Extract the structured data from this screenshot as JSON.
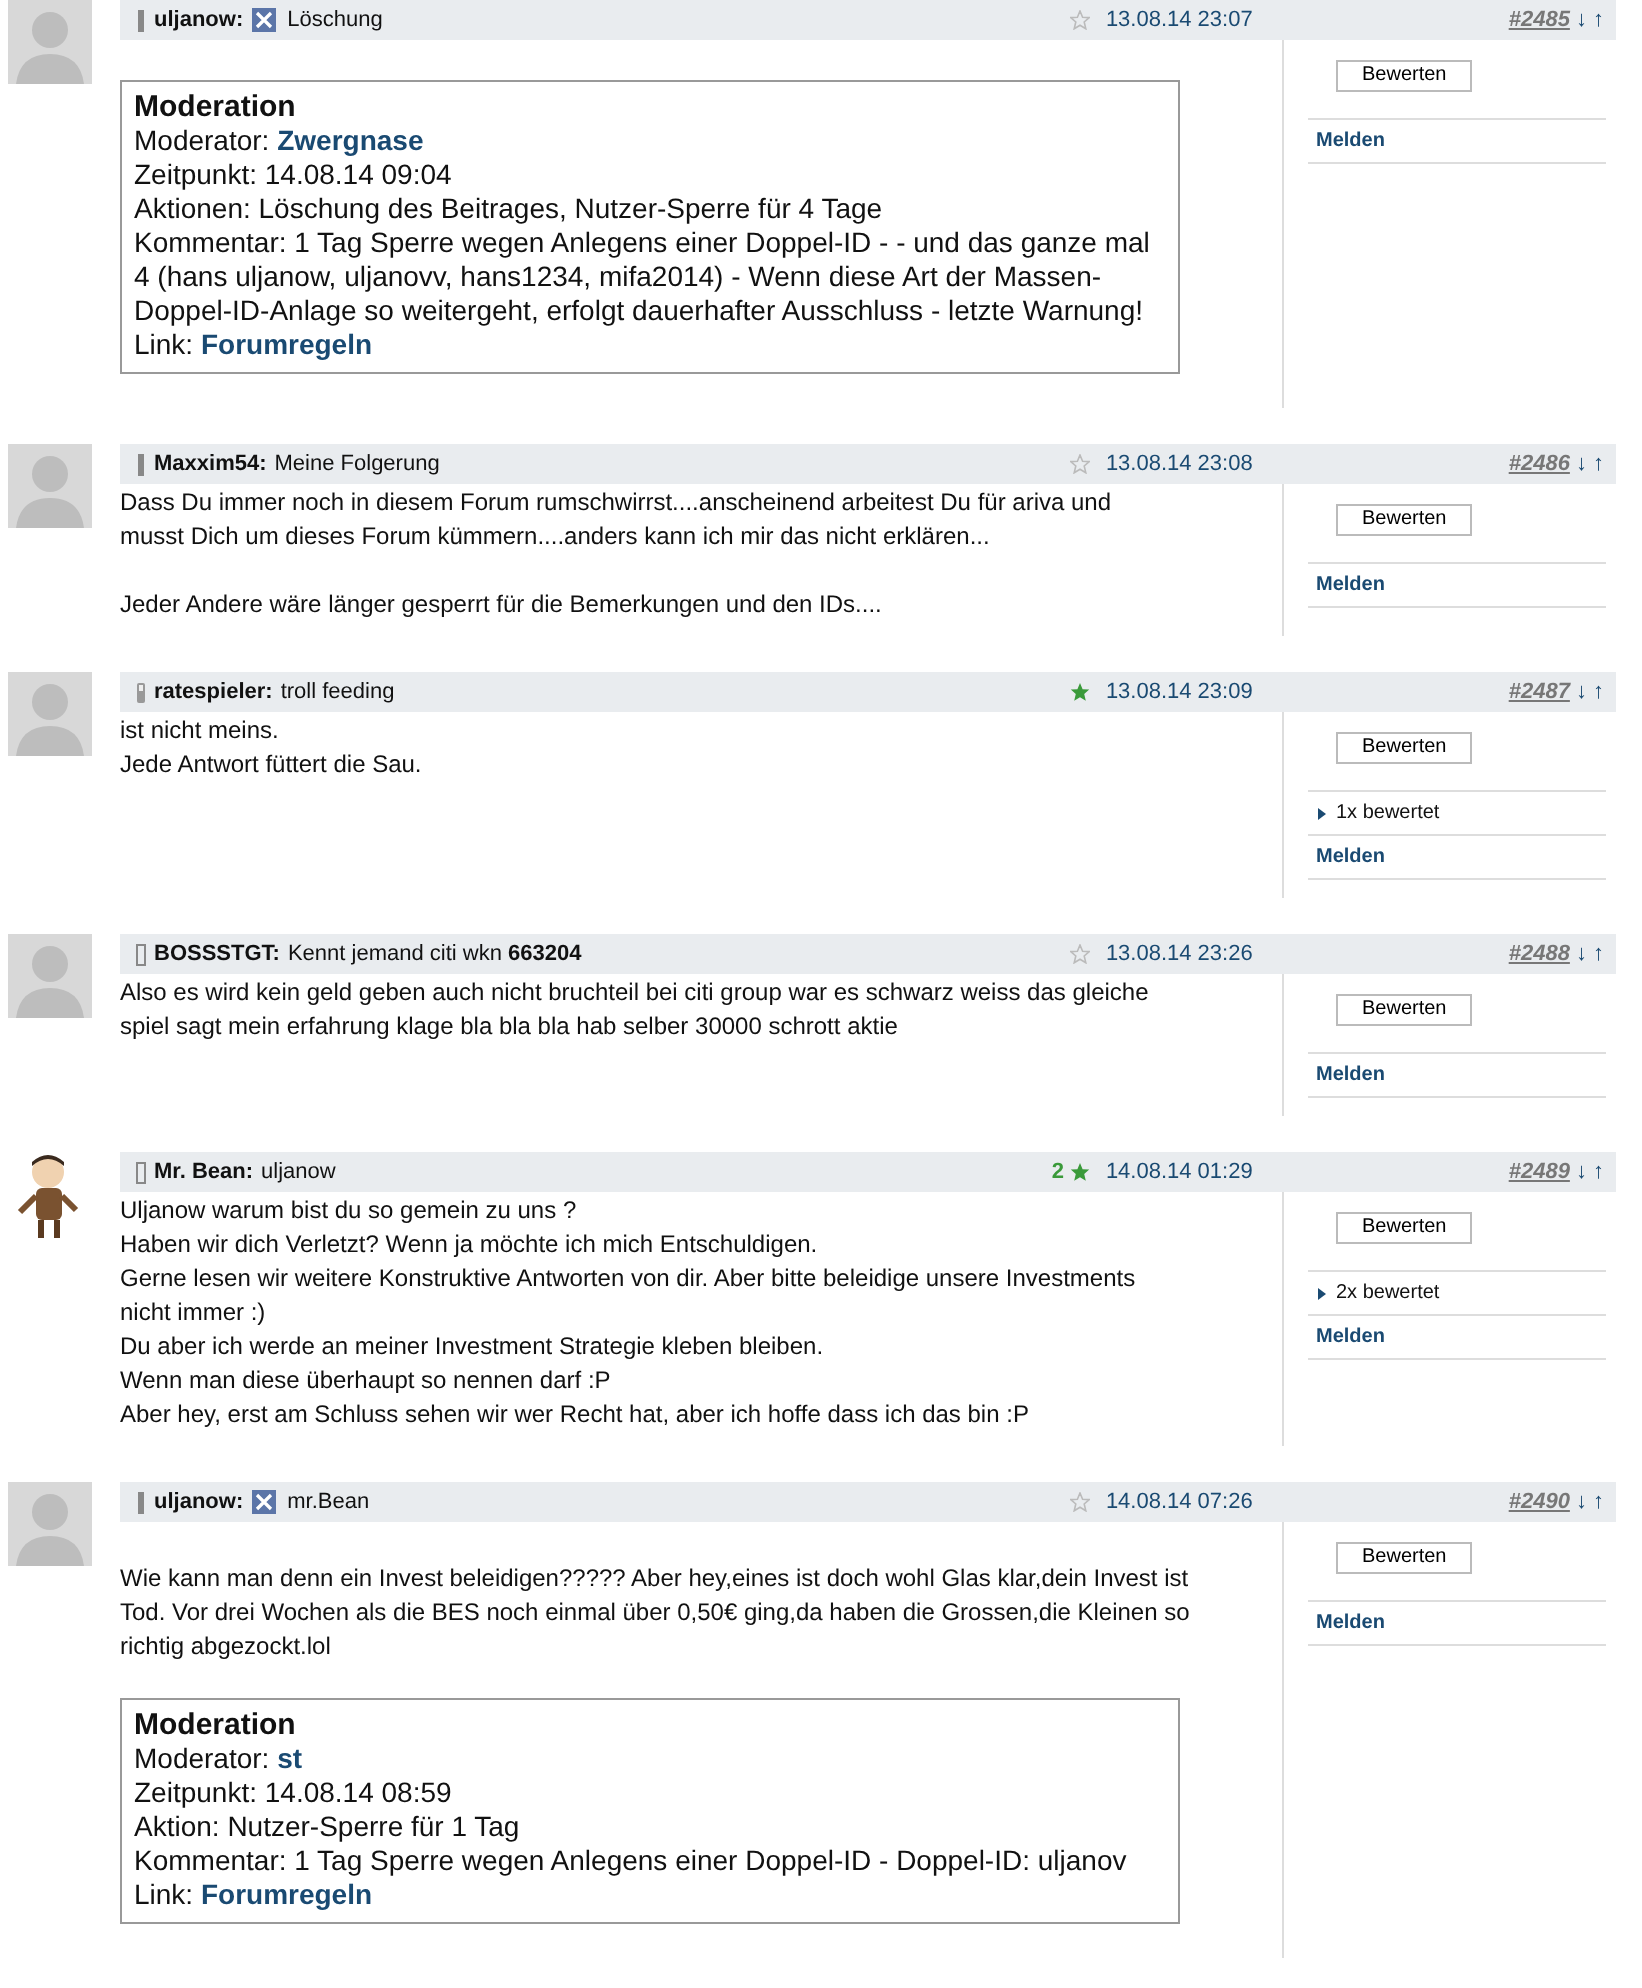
{
  "posts": [
    {
      "avatar": {
        "kind": "silhouette"
      },
      "status_icon": {
        "kind": "bar"
      },
      "author": "uljanow:",
      "x_mark": true,
      "title": "Löschung",
      "starred": false,
      "date": "13.08.14 23:07",
      "number": "#2485",
      "arrows": "↓ ↑",
      "gap_before": true,
      "moderation": {
        "title": "Moderation",
        "lines": [
          {
            "kind": "link",
            "label": "Moderator:",
            "link": "Zwergnase"
          },
          {
            "kind": "text",
            "text": "Zeitpunkt: 14.08.14 09:04"
          },
          {
            "kind": "text",
            "text": "Aktionen: Löschung des Beitrages, Nutzer-Sperre für 4 Tage"
          },
          {
            "kind": "text",
            "text": "Kommentar: 1 Tag Sperre wegen Anlegens einer Doppel-ID -  - und das ganze mal 4 (hans uljanow, uljanovv, hans1234, mifa2014) - Wenn diese Art der Massen-Doppel-ID-Anlage so weitergeht, erfolgt dauerhafter Ausschluss - letzte Warnung!"
          },
          {
            "kind": "link",
            "label": "Link:",
            "link": "Forumregeln"
          }
        ]
      },
      "sidebar": {
        "rate_button": "Bewerten",
        "report_link": "Melden"
      }
    },
    {
      "avatar": {
        "kind": "silhouette"
      },
      "status_icon": {
        "kind": "bar"
      },
      "author": "Maxxim54:",
      "x_mark": false,
      "title": "Meine Folgerung",
      "starred": false,
      "date": "13.08.14 23:08",
      "number": "#2486",
      "arrows": "↓ ↑",
      "gap_before": false,
      "paragraphs": [
        "Dass Du immer noch in diesem Forum rumschwirrst....anscheinend arbeitest Du für ariva und\nmusst Dich um dieses Forum kümmern....anders kann ich mir das nicht erklären...",
        "Jeder Andere wäre länger gesperrt für die Bemerkungen und den IDs...."
      ],
      "sidebar": {
        "rate_button": "Bewerten",
        "report_link": "Melden"
      }
    },
    {
      "avatar": {
        "kind": "silhouette"
      },
      "status_icon": {
        "kind": "phone"
      },
      "author": "ratespieler:",
      "x_mark": false,
      "title": "troll feeding",
      "starred": true,
      "date": "13.08.14 23:09",
      "number": "#2487",
      "arrows": "↓ ↑",
      "gap_before": false,
      "paragraphs": [
        "ist nicht meins.\nJede Antwort füttert die Sau."
      ],
      "sidebar": {
        "rate_button": "Bewerten",
        "ratings": {
          "label": "1x bewertet",
          "expanded": false
        },
        "report_link": "Melden"
      }
    },
    {
      "avatar": {
        "kind": "silhouette"
      },
      "status_icon": {
        "kind": "outline"
      },
      "author": "BOSSSTGT:",
      "x_mark": false,
      "title": "Kennt jemand citi wkn **663204**",
      "starred": false,
      "date": "13.08.14 23:26",
      "number": "#2488",
      "arrows": "↓ ↑",
      "gap_before": false,
      "paragraphs": [
        "Also es wird kein geld geben auch nicht bruchteil bei citi group war es schwarz weiss das gleiche\nspiel sagt mein erfahrung klage bla bla bla hab selber 30000 schrott aktie"
      ],
      "sidebar": {
        "rate_button": "Bewerten",
        "report_link": "Melden"
      }
    },
    {
      "avatar": {
        "kind": "figure"
      },
      "status_icon": {
        "kind": "outline"
      },
      "author": "Mr. Bean:",
      "x_mark": false,
      "title": "uljanow",
      "rating_count": "2",
      "starred": true,
      "date": "14.08.14 01:29",
      "number": "#2489",
      "arrows": "↓ ↑",
      "gap_before": false,
      "paragraphs": [
        "Uljanow warum bist du so gemein zu uns ?\nHaben wir dich Verletzt? Wenn ja möchte ich mich Entschuldigen.\nGerne lesen wir weitere Konstruktive Antworten von dir. Aber bitte beleidige unsere Investments\nnicht immer :)\nDu aber ich werde an meiner Investment Strategie kleben bleiben.\nWenn man diese überhaupt so nennen darf :P\nAber hey, erst am Schluss sehen wir wer Recht hat, aber ich hoffe dass ich das bin :P"
      ],
      "sidebar": {
        "rate_button": "Bewerten",
        "ratings": {
          "label": "2x bewertet",
          "expanded": false
        },
        "report_link": "Melden"
      }
    },
    {
      "avatar": {
        "kind": "silhouette"
      },
      "status_icon": {
        "kind": "bar"
      },
      "author": "uljanow:",
      "x_mark": true,
      "title": "mr.Bean",
      "starred": false,
      "date": "14.08.14 07:26",
      "number": "#2490",
      "arrows": "↓ ↑",
      "gap_before": true,
      "paragraphs": [
        "Wie kann man denn ein Invest beleidigen????? Aber hey,eines ist doch wohl Glas klar,dein Invest ist\nTod. Vor drei Wochen als die BES noch einmal über 0,50€ ging,da haben die Grossen,die Kleinen so\nrichtig abgezockt.lol"
      ],
      "moderation": {
        "title": "Moderation",
        "lines": [
          {
            "kind": "link",
            "label": "Moderator:",
            "link": "st"
          },
          {
            "kind": "text",
            "text": "Zeitpunkt: 14.08.14 08:59"
          },
          {
            "kind": "text",
            "text": "Aktion: Nutzer-Sperre für 1 Tag"
          },
          {
            "kind": "text",
            "text": "Kommentar: 1 Tag Sperre wegen Anlegens einer Doppel-ID - Doppel-ID: uljanov"
          },
          {
            "kind": "link",
            "label": "Link:",
            "link": "Forumregeln"
          }
        ]
      },
      "sidebar": {
        "rate_button": "Bewerten",
        "report_link": "Melden"
      }
    }
  ]
}
